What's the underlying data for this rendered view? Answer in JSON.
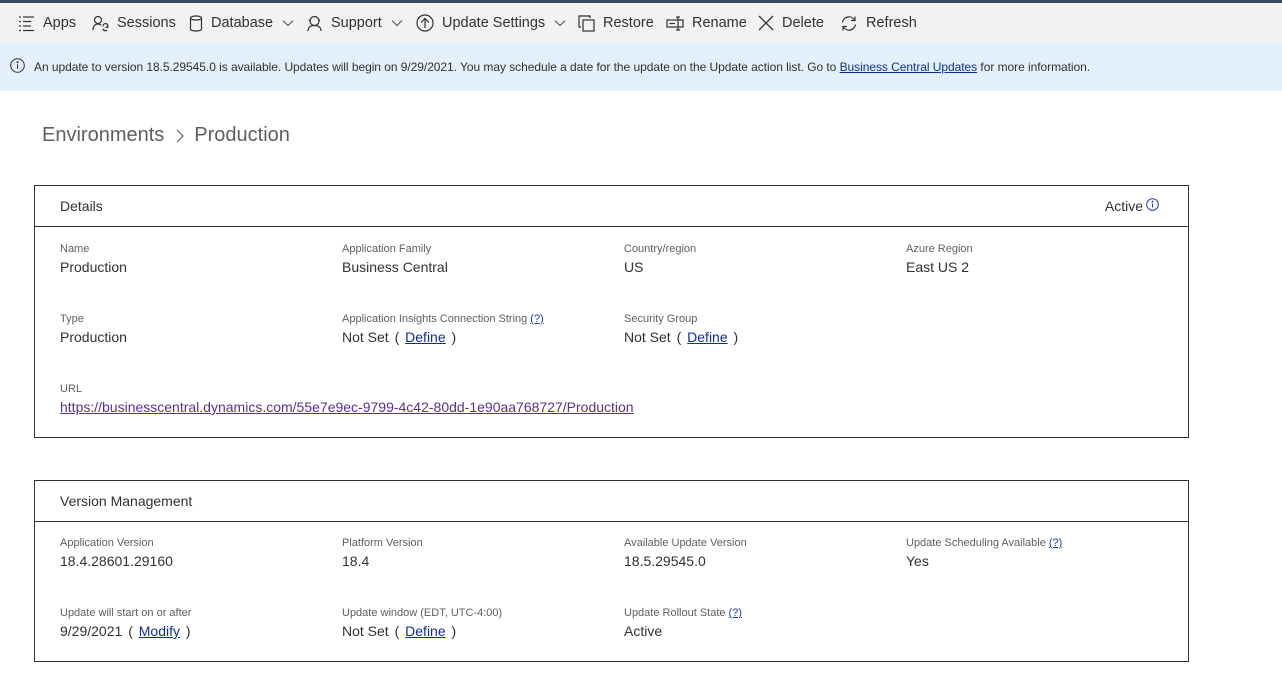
{
  "commandbar": {
    "items": [
      {
        "label": "Apps",
        "icon": "list-icon"
      },
      {
        "label": "Sessions",
        "icon": "sessions-icon",
        "highlighted": true
      },
      {
        "label": "Database",
        "icon": "database-icon",
        "has_dropdown": true
      },
      {
        "label": "Support",
        "icon": "support-icon",
        "has_dropdown": true
      },
      {
        "label": "Update Settings",
        "icon": "update-icon",
        "has_dropdown": true
      },
      {
        "label": "Restore",
        "icon": "restore-icon"
      },
      {
        "label": "Rename",
        "icon": "rename-icon"
      },
      {
        "label": "Delete",
        "icon": "delete-icon"
      },
      {
        "label": "Refresh",
        "icon": "refresh-icon"
      }
    ],
    "highlight_color": "#ffff33"
  },
  "banner": {
    "text_before": "An update to version 18.5.29545.0 is available. Updates will begin on 9/29/2021. You may schedule a date for the update on the Update action list. Go to ",
    "link_text": "Business Central Updates",
    "text_after": " for more information.",
    "background": "#e4f0fb"
  },
  "breadcrumb": {
    "parent": "Environments",
    "current": "Production"
  },
  "details": {
    "title": "Details",
    "status": "Active",
    "name": {
      "label": "Name",
      "value": "Production"
    },
    "application_family": {
      "label": "Application Family",
      "value": "Business Central"
    },
    "country_region": {
      "label": "Country/region",
      "value": "US"
    },
    "azure_region": {
      "label": "Azure Region",
      "value": "East US 2"
    },
    "type": {
      "label": "Type",
      "value": "Production"
    },
    "app_insights": {
      "label": "Application Insights Connection String",
      "help": "(?)",
      "value": "Not Set",
      "paren_open": "(",
      "link": "Define",
      "paren_close": ")"
    },
    "security_group": {
      "label": "Security Group",
      "value": "Not Set",
      "paren_open": "(",
      "link": "Define",
      "paren_close": ")"
    },
    "url": {
      "label": "URL",
      "value": "https://businesscentral.dynamics.com/55e7e9ec-9799-4c42-80dd-1e90aa768727/Production"
    }
  },
  "version_management": {
    "title": "Version Management",
    "application_version": {
      "label": "Application Version",
      "value": "18.4.28601.29160"
    },
    "platform_version": {
      "label": "Platform Version",
      "value": "18.4"
    },
    "available_update_version": {
      "label": "Available Update Version",
      "value": "18.5.29545.0"
    },
    "update_scheduling_available": {
      "label": "Update Scheduling Available",
      "help": "(?)",
      "value": "Yes"
    },
    "update_start": {
      "label": "Update will start on or after",
      "value": "9/29/2021",
      "paren_open": "(",
      "link": "Modify",
      "paren_close": ")"
    },
    "update_window": {
      "label": "Update window (EDT, UTC-4:00)",
      "value": "Not Set",
      "paren_open": "(",
      "link": "Define",
      "paren_close": ")"
    },
    "update_rollout_state": {
      "label": "Update Rollout State",
      "help": "(?)",
      "value": "Active"
    }
  }
}
